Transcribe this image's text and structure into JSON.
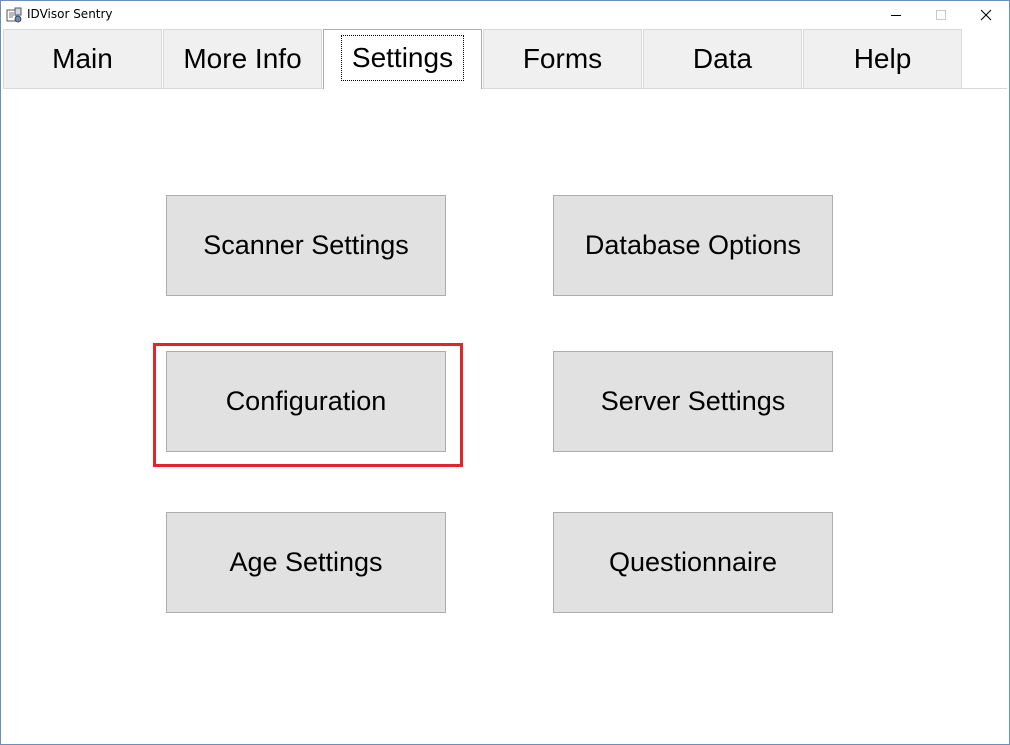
{
  "window": {
    "title": "IDVisor Sentry",
    "icons": {
      "app": "scanner-app-icon",
      "minimize": "minimize-icon",
      "maximize": "maximize-icon",
      "close": "close-icon"
    }
  },
  "tabs": [
    {
      "label": "Main"
    },
    {
      "label": "More Info"
    },
    {
      "label": "Settings",
      "selected": true
    },
    {
      "label": "Forms"
    },
    {
      "label": "Data"
    },
    {
      "label": "Help"
    }
  ],
  "settings_panel": {
    "buttons": {
      "scanner_settings": "Scanner Settings",
      "database_options": "Database Options",
      "configuration": "Configuration",
      "server_settings": "Server Settings",
      "age_settings": "Age Settings",
      "questionnaire": "Questionnaire"
    },
    "highlighted": "configuration"
  },
  "colors": {
    "highlight_border": "#e3242b",
    "button_face": "#e1e1e1",
    "tab_inactive": "#f0f0f0"
  }
}
